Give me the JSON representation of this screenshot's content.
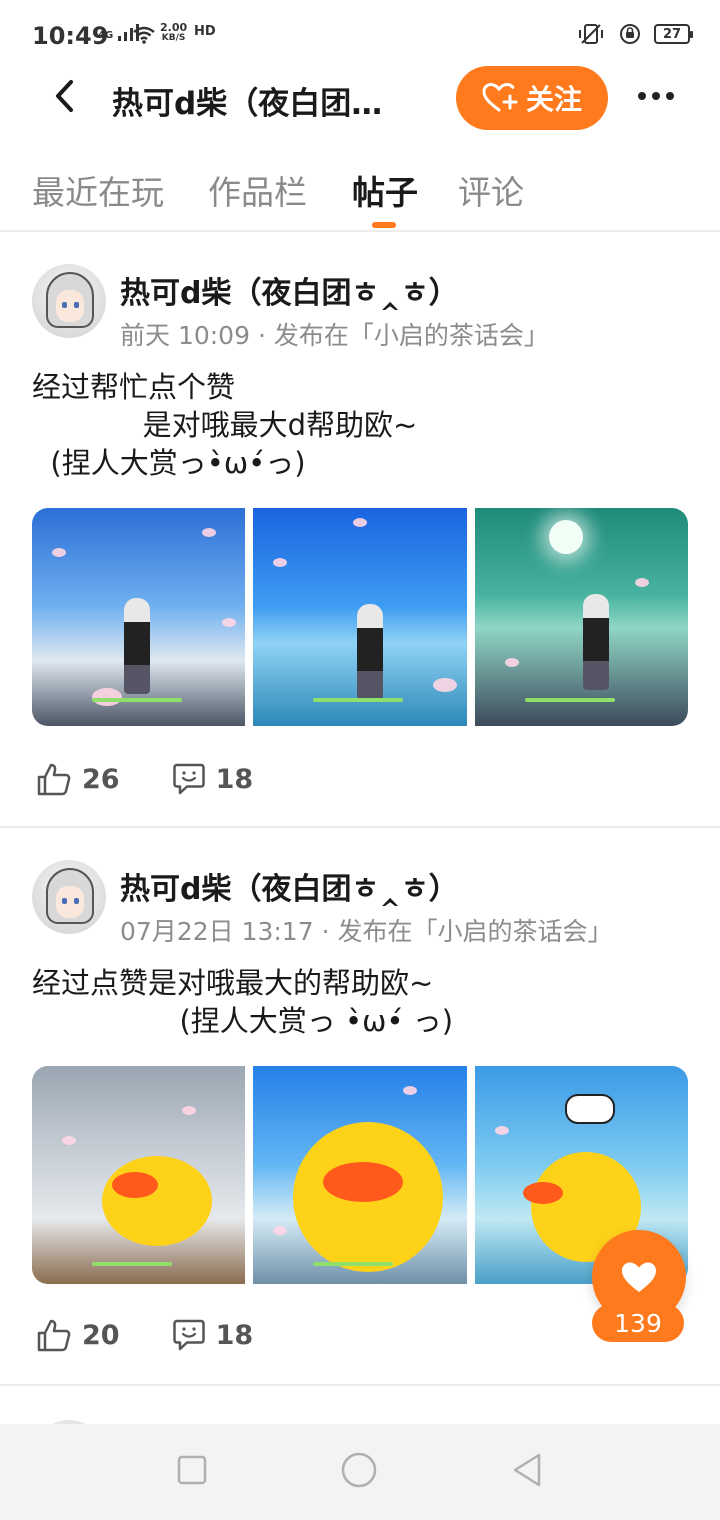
{
  "status_bar": {
    "time": "10:49",
    "network": "4G",
    "speed_value": "2.00",
    "speed_unit": "KB/S",
    "hd": "HD",
    "battery": "27"
  },
  "header": {
    "title": "热可d柴（夜白团…",
    "follow_label": "关注"
  },
  "tabs": [
    {
      "label": "最近在玩",
      "active": false
    },
    {
      "label": "作品栏",
      "active": false
    },
    {
      "label": "帖子",
      "active": true
    },
    {
      "label": "评论",
      "active": false
    }
  ],
  "posts": [
    {
      "author": "热可d柴（夜白团ㅎ‸ㅎ）",
      "meta": "前天 10:09 · 发布在「小启的茶话会」",
      "content": "经过帮忙点个赞\n            是对哦最大d帮助欧~\n  (捏人大赏っ•̀ω•́っ)",
      "likes": "26",
      "comments": "18"
    },
    {
      "author": "热可d柴（夜白团ㅎ‸ㅎ）",
      "meta": "07月22日 13:17 · 发布在「小启的茶话会」",
      "content": "经过点赞是对哦最大的帮助欧~\n                (捏人大赏っ •̀ω•́ っ)",
      "likes": "20",
      "comments": "18"
    }
  ],
  "floating_like": {
    "count": "139"
  },
  "colors": {
    "accent": "#ff7a1c",
    "text_primary": "#1a1a1a",
    "text_secondary": "#8c8c8c",
    "divider": "#ececec"
  },
  "icons": {
    "back": "chevron-left-icon",
    "follow": "heart-plus-icon",
    "more": "more-dots-icon",
    "like": "thumbs-up-icon",
    "comment": "comment-smile-icon",
    "float_like": "heart-icon"
  }
}
